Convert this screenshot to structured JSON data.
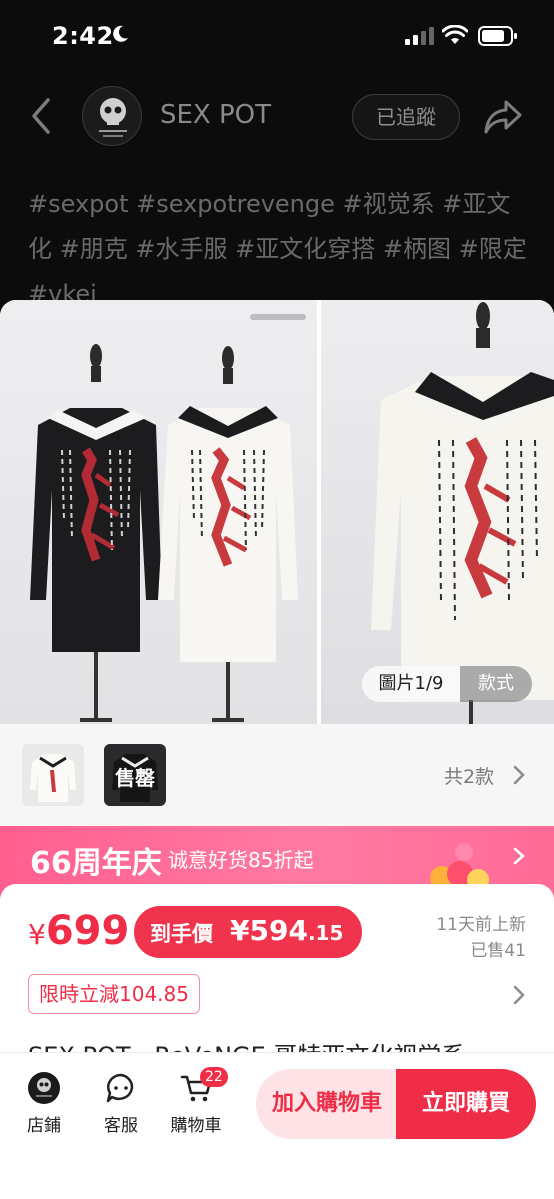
{
  "status_bar": {
    "time": "2:42"
  },
  "header": {
    "shop_name": "SEX POT",
    "follow_label": "已追蹤",
    "hashtags": "#sexpot #sexpotrevenge #视觉系 #亚文化 #朋克 #水手服 #亚文化穿搭 #柄图 #限定 #vkei"
  },
  "gallery": {
    "image_counter": "圖片1/9",
    "style_label": "款式"
  },
  "variants": {
    "sold_out_label": "售罄",
    "count_label": "共2款"
  },
  "promo": {
    "logo": "66周年庆",
    "text": "诚意好货85折起"
  },
  "price": {
    "currency": "¥",
    "amount": "699",
    "final_label": "到手價",
    "final_currency": "¥",
    "final_integer": "594",
    "final_decimal": ".15",
    "listed_ago": "11天前上新",
    "sold": "已售41",
    "discount_tag": "限時立減104.85",
    "title_preview": "SEX POT - ReVeNGE 哥特亚文化视觉系"
  },
  "bottom_bar": {
    "store_label": "店鋪",
    "service_label": "客服",
    "cart_label": "購物車",
    "cart_count": "22",
    "add_to_cart": "加入購物車",
    "buy_now": "立即購買"
  },
  "colors": {
    "accent": "#f02d47",
    "promo_pink": "#ff6b97",
    "overlay_bg": "#0c0c0d"
  }
}
